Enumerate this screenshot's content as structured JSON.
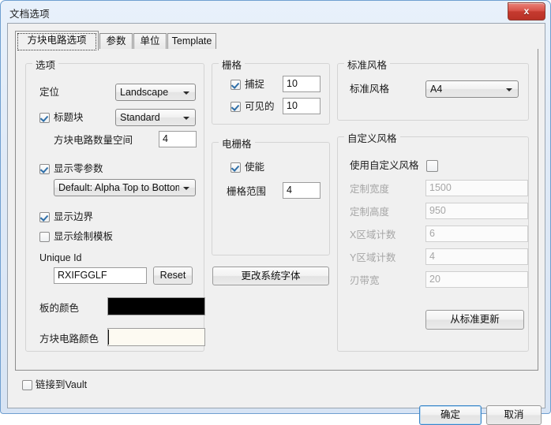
{
  "window": {
    "title": "文档选项",
    "close_label": "x"
  },
  "tabs": [
    {
      "label": "方块电路选项",
      "selected": true
    },
    {
      "label": "参数",
      "selected": false
    },
    {
      "label": "单位",
      "selected": false
    },
    {
      "label": "Template",
      "selected": false
    }
  ],
  "options_group": {
    "legend": "选项",
    "orientation_label": "定位",
    "orientation_value": "Landscape",
    "title_block_label": "标题块",
    "title_block_checked": true,
    "title_block_value": "Standard",
    "sheet_number_space_label": "方块电路数量空间",
    "sheet_number_space_value": "4",
    "show_zero_params_label": "显示零参数",
    "show_zero_params_checked": true,
    "ordering_value": "Default: Alpha Top to Bottom",
    "show_border_label": "显示边界",
    "show_border_checked": true,
    "show_template_label": "显示绘制模板",
    "show_template_checked": false,
    "unique_id_label": "Unique Id",
    "unique_id_value": "RXIFGGLF",
    "reset_label": "Reset",
    "board_color_label": "板的颜色",
    "board_color_value": "#000000",
    "sheet_color_label": "方块电路颜色",
    "sheet_color_value": "#fdfaf2"
  },
  "grid_group": {
    "legend": "栅格",
    "snap_label": "捕捉",
    "snap_checked": true,
    "snap_value": "10",
    "visible_label": "可见的",
    "visible_checked": true,
    "visible_value": "10"
  },
  "electrical_grid_group": {
    "legend": "电栅格",
    "enable_label": "使能",
    "enable_checked": true,
    "range_label": "栅格范围",
    "range_value": "4"
  },
  "change_system_font_label": "更改系统字体",
  "standard_style_group": {
    "legend": "标准风格",
    "style_label": "标准风格",
    "style_value": "A4"
  },
  "custom_style_group": {
    "legend": "自定义风格",
    "use_custom_label": "使用自定义风格",
    "use_custom_checked": false,
    "width_label": "定制宽度",
    "width_value": "1500",
    "height_label": "定制高度",
    "height_value": "950",
    "x_zones_label": "X区域计数",
    "x_zones_value": "6",
    "y_zones_label": "Y区域计数",
    "y_zones_value": "4",
    "margin_label": "刃带宽",
    "margin_value": "20",
    "update_from_standard_label": "从标准更新"
  },
  "footer": {
    "link_to_vault_label": "链接到Vault",
    "link_to_vault_checked": false,
    "ok_label": "确定",
    "cancel_label": "取消"
  }
}
